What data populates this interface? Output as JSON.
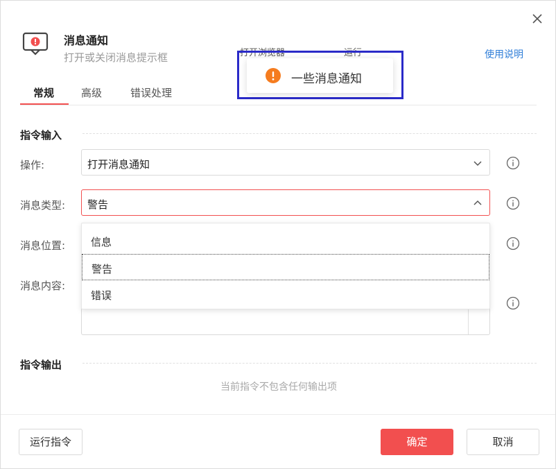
{
  "header": {
    "title": "消息通知",
    "subtitle": "打开或关闭消息提示框",
    "help_link": "使用说明"
  },
  "tabs": [
    {
      "label": "常规",
      "active": true
    },
    {
      "label": "高级",
      "active": false
    },
    {
      "label": "错误处理",
      "active": false
    }
  ],
  "input_section": {
    "title": "指令输入"
  },
  "fields": {
    "operation": {
      "label": "操作:",
      "value": "打开消息通知"
    },
    "message_type": {
      "label": "消息类型:",
      "value": "警告"
    },
    "message_position": {
      "label": "消息位置:"
    },
    "message_content": {
      "label": "消息内容:"
    }
  },
  "dropdown": {
    "options": [
      "信息",
      "警告",
      "错误"
    ],
    "selected": "警告"
  },
  "output_section": {
    "title": "指令输出",
    "empty_text": "当前指令不包含任何输出项"
  },
  "footer": {
    "run_label": "运行指令",
    "confirm_label": "确定",
    "cancel_label": "取消"
  },
  "toast": {
    "text": "一些消息通知",
    "behind_left": "打开浏览器",
    "behind_right": "运行"
  },
  "colors": {
    "accent": "#f24f4f",
    "link": "#2f7ed8",
    "warning": "#f57c1f",
    "highlight_frame": "#2a2ac8"
  }
}
